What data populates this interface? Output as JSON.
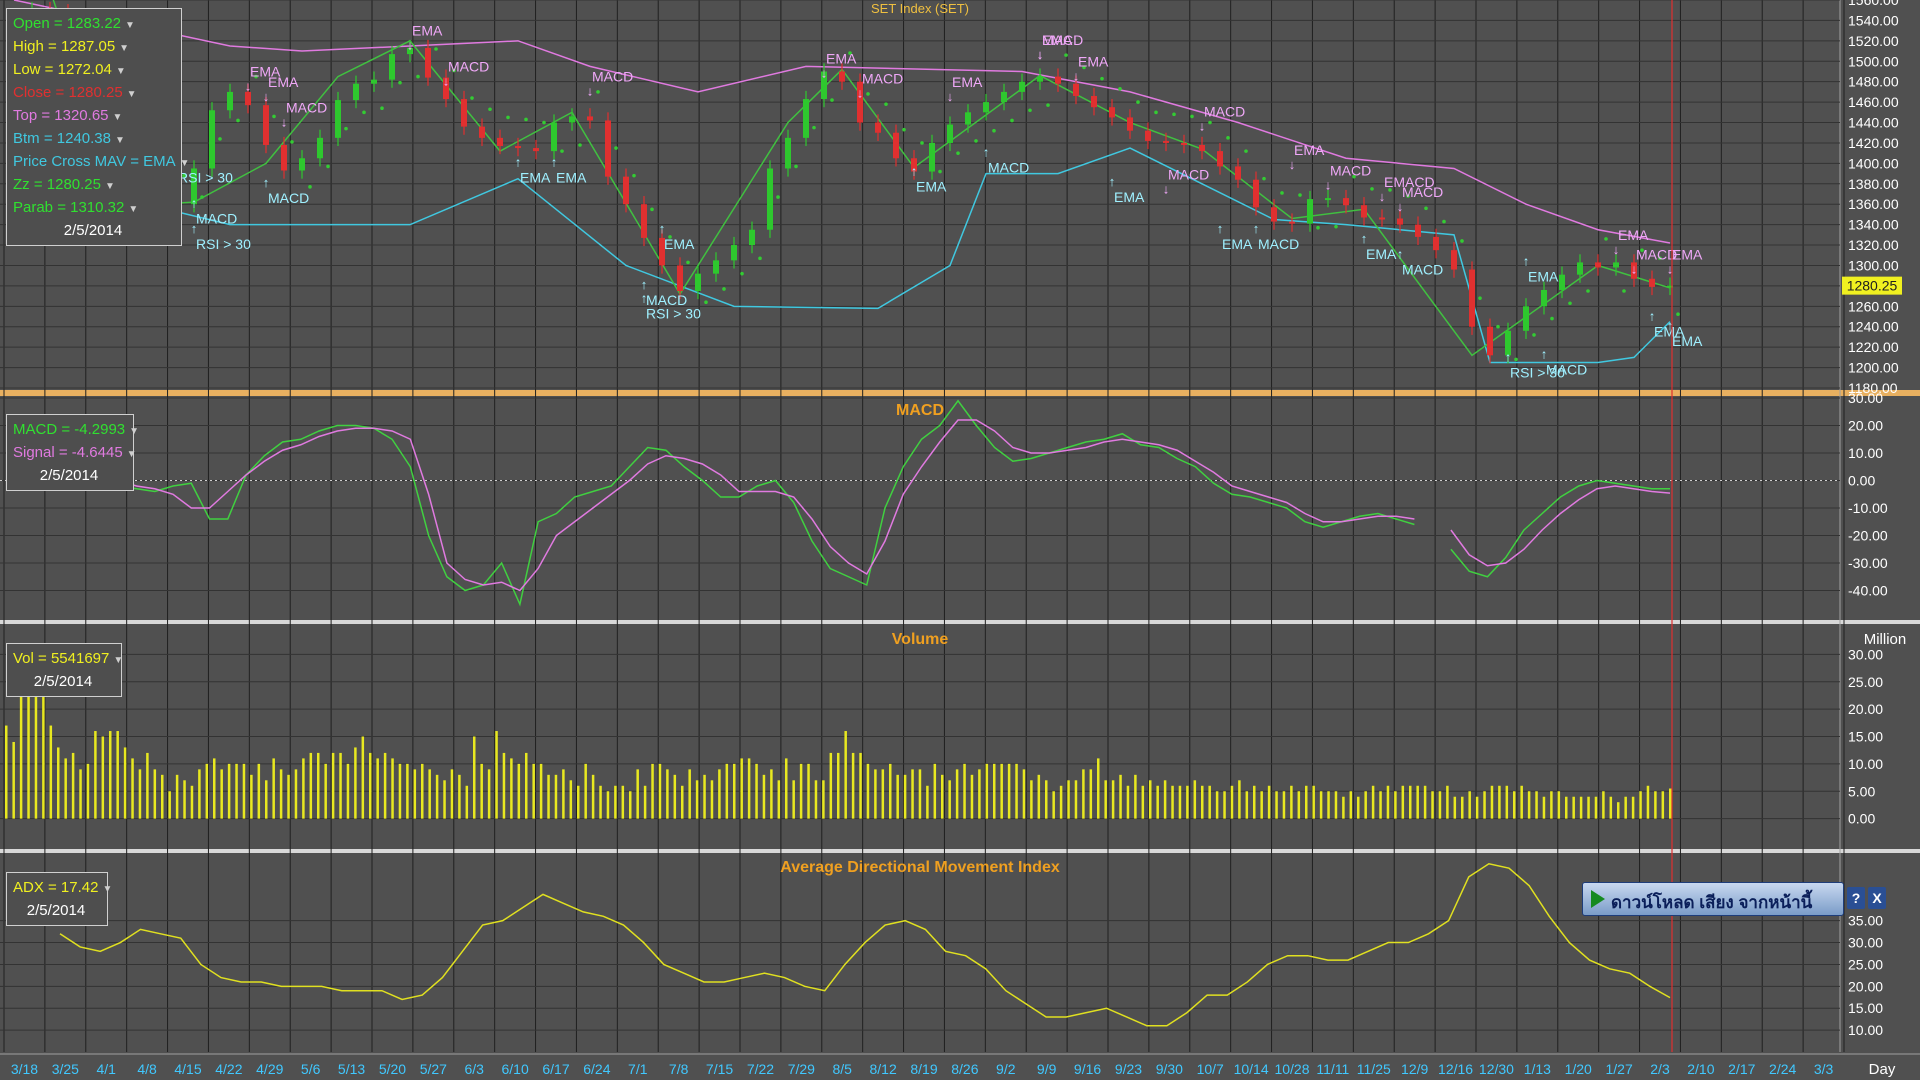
{
  "chart_data": [
    {
      "type": "candlestick",
      "title": "SET Index (SET)",
      "ylim": [
        1180,
        1560
      ],
      "y_ticks": [
        "1180.00",
        "1200.00",
        "1220.00",
        "1240.00",
        "1260.00",
        "1280.00",
        "1300.00",
        "1320.00",
        "1340.00",
        "1360.00",
        "1380.00",
        "1400.00",
        "1420.00",
        "1440.00",
        "1460.00",
        "1480.00",
        "1500.00",
        "1520.00",
        "1540.00",
        "1560.00"
      ],
      "last_price": "1280.25",
      "closes": [
        1540,
        1550,
        1548,
        1490,
        1458,
        1465,
        1368,
        1362,
        1379,
        1360,
        1395,
        1452,
        1470,
        1457,
        1418,
        1393,
        1405,
        1425,
        1462,
        1478,
        1482,
        1507,
        1513,
        1484,
        1463,
        1436,
        1425,
        1417,
        1415,
        1412,
        1440,
        1446,
        1442,
        1387,
        1360,
        1327,
        1300,
        1275,
        1292,
        1305,
        1320,
        1335,
        1395,
        1425,
        1463,
        1490,
        1480,
        1440,
        1430,
        1405,
        1392,
        1420,
        1438,
        1450,
        1460,
        1470,
        1480,
        1485,
        1478,
        1466,
        1455,
        1445,
        1432,
        1422,
        1420,
        1418,
        1412,
        1397,
        1384,
        1357,
        1343,
        1341,
        1365,
        1366,
        1359,
        1347,
        1346,
        1340,
        1328,
        1315,
        1296,
        1240,
        1212,
        1236,
        1260,
        1276,
        1291,
        1303,
        1298,
        1303,
        1287,
        1279,
        1280.25
      ],
      "zigzag": [
        [
          2,
          1570
        ],
        [
          6,
          1358
        ],
        [
          10,
          1362
        ],
        [
          14,
          1400
        ],
        [
          18,
          1485
        ],
        [
          22,
          1520
        ],
        [
          27,
          1412
        ],
        [
          31,
          1450
        ],
        [
          37,
          1272
        ],
        [
          43,
          1440
        ],
        [
          46,
          1492
        ],
        [
          50,
          1396
        ],
        [
          57,
          1486
        ],
        [
          62,
          1440
        ],
        [
          66,
          1414
        ],
        [
          71,
          1346
        ],
        [
          75,
          1355
        ],
        [
          81,
          1212
        ],
        [
          88,
          1300
        ],
        [
          92,
          1278
        ]
      ],
      "bands_top": [
        [
          0,
          1560
        ],
        [
          12,
          1515
        ],
        [
          16,
          1510
        ],
        [
          22,
          1515
        ],
        [
          28,
          1520
        ],
        [
          32,
          1495
        ],
        [
          38,
          1470
        ],
        [
          44,
          1495
        ],
        [
          56,
          1490
        ],
        [
          62,
          1470
        ],
        [
          68,
          1440
        ],
        [
          74,
          1405
        ],
        [
          80,
          1395
        ],
        [
          84,
          1360
        ],
        [
          88,
          1335
        ],
        [
          92,
          1322
        ]
      ],
      "bands_bottom": [
        [
          0,
          1460
        ],
        [
          6,
          1457
        ],
        [
          8,
          1357
        ],
        [
          12,
          1340
        ],
        [
          16,
          1340
        ],
        [
          22,
          1340
        ],
        [
          28,
          1385
        ],
        [
          34,
          1300
        ],
        [
          40,
          1260
        ],
        [
          48,
          1258
        ],
        [
          52,
          1300
        ],
        [
          54,
          1390
        ],
        [
          58,
          1390
        ],
        [
          62,
          1415
        ],
        [
          66,
          1380
        ],
        [
          70,
          1345
        ],
        [
          74,
          1340
        ],
        [
          80,
          1330
        ],
        [
          82,
          1205
        ],
        [
          88,
          1205
        ],
        [
          90,
          1210
        ],
        [
          92,
          1245
        ]
      ],
      "annotations": [
        {
          "text": "MACD",
          "i": 1,
          "y": 1500,
          "color": "#9ff0ff"
        },
        {
          "text": "RSI > 30",
          "i": 9,
          "y": 1395,
          "color": "#9ff0ff"
        },
        {
          "text": "MACD",
          "i": 10,
          "y": 1355,
          "color": "#9ff0ff"
        },
        {
          "text": "RSI > 30",
          "i": 10,
          "y": 1330,
          "color": "#9ff0ff"
        },
        {
          "text": "EMA",
          "i": 13,
          "y": 1485,
          "color": "#f0a8f8"
        },
        {
          "text": "EMA",
          "i": 14,
          "y": 1475,
          "color": "#f0a8f8"
        },
        {
          "text": "MACD",
          "i": 15,
          "y": 1450,
          "color": "#f0a8f8"
        },
        {
          "text": "MACD",
          "i": 14,
          "y": 1375,
          "color": "#9ff0ff"
        },
        {
          "text": "EMA",
          "i": 22,
          "y": 1525,
          "color": "#f0a8f8"
        },
        {
          "text": "MACD",
          "i": 24,
          "y": 1490,
          "color": "#f0a8f8"
        },
        {
          "text": "EMA",
          "i": 28,
          "y": 1395,
          "color": "#9ff0ff"
        },
        {
          "text": "EMA",
          "i": 30,
          "y": 1395,
          "color": "#9ff0ff"
        },
        {
          "text": "MACD",
          "i": 32,
          "y": 1480,
          "color": "#f0a8f8"
        },
        {
          "text": "EMA",
          "i": 36,
          "y": 1330,
          "color": "#9ff0ff"
        },
        {
          "text": "MACD",
          "i": 35,
          "y": 1275,
          "color": "#9ff0ff"
        },
        {
          "text": "RSI > 30",
          "i": 35,
          "y": 1262,
          "color": "#9ff0ff"
        },
        {
          "text": "EMA",
          "i": 45,
          "y": 1498,
          "color": "#f0a8f8"
        },
        {
          "text": "MACD",
          "i": 47,
          "y": 1478,
          "color": "#f0a8f8"
        },
        {
          "text": "EMA",
          "i": 50,
          "y": 1386,
          "color": "#9ff0ff"
        },
        {
          "text": "EMA",
          "i": 52,
          "y": 1475,
          "color": "#f0a8f8"
        },
        {
          "text": "MACD",
          "i": 54,
          "y": 1405,
          "color": "#9ff0ff"
        },
        {
          "text": "EMA",
          "i": 57,
          "y": 1516,
          "color": "#f0a8f8"
        },
        {
          "text": "MACD",
          "i": 57,
          "y": 1516,
          "color": "#f0a8f8"
        },
        {
          "text": "EMA",
          "i": 59,
          "y": 1495,
          "color": "#f0a8f8"
        },
        {
          "text": "EMA",
          "i": 61,
          "y": 1376,
          "color": "#9ff0ff"
        },
        {
          "text": "MACD",
          "i": 64,
          "y": 1384,
          "color": "#f0a8f8"
        },
        {
          "text": "MACD",
          "i": 66,
          "y": 1446,
          "color": "#f0a8f8"
        },
        {
          "text": "EMA",
          "i": 67,
          "y": 1330,
          "color": "#9ff0ff"
        },
        {
          "text": "MACD",
          "i": 69,
          "y": 1330,
          "color": "#9ff0ff"
        },
        {
          "text": "EMA",
          "i": 71,
          "y": 1408,
          "color": "#f0a8f8"
        },
        {
          "text": "MACD",
          "i": 73,
          "y": 1388,
          "color": "#f0a8f8"
        },
        {
          "text": "EMA",
          "i": 75,
          "y": 1320,
          "color": "#9ff0ff"
        },
        {
          "text": "EMACD",
          "i": 76,
          "y": 1377,
          "color": "#f0a8f8"
        },
        {
          "text": "MACD",
          "i": 77,
          "y": 1367,
          "color": "#f0a8f8"
        },
        {
          "text": "MACD",
          "i": 77,
          "y": 1305,
          "color": "#9ff0ff"
        },
        {
          "text": "EMA",
          "i": 84,
          "y": 1298,
          "color": "#9ff0ff"
        },
        {
          "text": "RSI > 30",
          "i": 83,
          "y": 1204,
          "color": "#9ff0ff"
        },
        {
          "text": "MACD",
          "i": 85,
          "y": 1207,
          "color": "#9ff0ff"
        },
        {
          "text": "EMA",
          "i": 89,
          "y": 1325,
          "color": "#f0a8f8"
        },
        {
          "text": "MACD",
          "i": 90,
          "y": 1306,
          "color": "#f0a8f8"
        },
        {
          "text": "EMA",
          "i": 92,
          "y": 1306,
          "color": "#f0a8f8"
        },
        {
          "text": "EMA",
          "i": 91,
          "y": 1244,
          "color": "#9ff0ff"
        },
        {
          "text": "EMA",
          "i": 92,
          "y": 1235,
          "color": "#9ff0ff"
        }
      ]
    },
    {
      "type": "line",
      "title": "MACD",
      "ylim": [
        -50,
        30
      ],
      "y_ticks": [
        "-40.00",
        "-30.00",
        "-20.00",
        "-10.00",
        "0.00",
        "10.00",
        "20.00",
        "30.00"
      ],
      "series": [
        {
          "name": "MACD",
          "color": "#40d040",
          "values": [
            0,
            -2,
            -3,
            -4,
            -2,
            -1,
            -14,
            -14,
            2,
            9,
            14,
            15,
            18,
            20,
            20,
            19,
            15,
            5,
            -20,
            -35,
            -40,
            -38,
            -30,
            -45,
            -15,
            -12,
            -6,
            -4,
            -2,
            5,
            12,
            11,
            5,
            0,
            -6,
            -6,
            -2,
            0,
            -8,
            -22,
            -32,
            -35,
            -38,
            -10,
            5,
            15,
            20,
            29,
            20,
            12,
            7,
            8,
            10,
            12,
            14,
            15,
            17,
            13,
            12,
            8,
            5,
            -1,
            -5,
            -6,
            -8,
            -10,
            -15,
            -17,
            -15,
            -13,
            -12,
            -14,
            -16,
            null,
            -25,
            -33,
            -35,
            -28,
            -18,
            -12,
            -6,
            -2,
            0,
            -1,
            -2,
            -3,
            -3
          ]
        },
        {
          "name": "Signal",
          "color": "#e07ae0",
          "values": [
            1,
            0,
            -2,
            -3,
            -5,
            -10,
            -10,
            -4,
            2,
            7,
            11,
            13,
            16,
            18,
            19,
            19,
            18,
            15,
            -5,
            -30,
            -36,
            -38,
            -37,
            -40,
            -32,
            -20,
            -15,
            -10,
            -5,
            0,
            6,
            9,
            8,
            6,
            2,
            -4,
            -4,
            -4,
            -6,
            -14,
            -24,
            -30,
            -34,
            -22,
            -5,
            5,
            14,
            22,
            22,
            18,
            12,
            10,
            10,
            11,
            12,
            14,
            15,
            14,
            13,
            11,
            7,
            3,
            -2,
            -4,
            -6,
            -8,
            -12,
            -15,
            -15,
            -14,
            -13,
            -13,
            -14,
            null,
            -18,
            -27,
            -31,
            -30,
            -25,
            -18,
            -12,
            -7,
            -3,
            -2,
            -3,
            -4,
            -4.6
          ]
        }
      ]
    },
    {
      "type": "bar",
      "title": "Volume",
      "unit": "Million",
      "ylim": [
        -5,
        35
      ],
      "y_ticks": [
        "0.00",
        "5.00",
        "10.00",
        "15.00",
        "20.00",
        "25.00",
        "30.00"
      ],
      "values": [
        17,
        14,
        25,
        25,
        25,
        25,
        17,
        13,
        11,
        12,
        9,
        10,
        16,
        15,
        16,
        16,
        13,
        11,
        9,
        12,
        9,
        8,
        5,
        8,
        7,
        6,
        9,
        10,
        11,
        9,
        10,
        10,
        10,
        8,
        10,
        7,
        11,
        9,
        8,
        9,
        11,
        12,
        12,
        10,
        12,
        12,
        10,
        13,
        15,
        12,
        11,
        12,
        11,
        10,
        10,
        9,
        10,
        9,
        8,
        7,
        9,
        8,
        6,
        15,
        10,
        9,
        16,
        12,
        11,
        10,
        12,
        10,
        10,
        8,
        8,
        9,
        7,
        6,
        10,
        8,
        6,
        5,
        6,
        6,
        5,
        9,
        6,
        10,
        10,
        9,
        8,
        6,
        9,
        7,
        8,
        7,
        9,
        10,
        10,
        11,
        11,
        10,
        8,
        9,
        7,
        11,
        7,
        10,
        10,
        7,
        7,
        12,
        12,
        16,
        12,
        12,
        10,
        9,
        9,
        10,
        8,
        8,
        9,
        9,
        6,
        10,
        8,
        7,
        9,
        10,
        8,
        9,
        10,
        10,
        10,
        10,
        10,
        9,
        7,
        8,
        7,
        5,
        6,
        7,
        7,
        9,
        9,
        11,
        7,
        7,
        8,
        6,
        8,
        6,
        7,
        6,
        7,
        6,
        6,
        6,
        7,
        6,
        6,
        5,
        5,
        6,
        7,
        5,
        6,
        5,
        6,
        5,
        5,
        6,
        5,
        6,
        6,
        5,
        5,
        5,
        4,
        5,
        4,
        5,
        6,
        5,
        6,
        5,
        6,
        6,
        6,
        6,
        5,
        5,
        6,
        4,
        4,
        5,
        4,
        5,
        6,
        6,
        6,
        5,
        6,
        5,
        5,
        4,
        5,
        5,
        4,
        4,
        4,
        4,
        4,
        5,
        4,
        3,
        4,
        4,
        5,
        6,
        5,
        5,
        5.5
      ]
    },
    {
      "type": "line",
      "title": "Average Directional Movement Index",
      "ylim": [
        5,
        50
      ],
      "y_ticks": [
        "10.00",
        "15.00",
        "20.00",
        "25.00",
        "30.00",
        "35.00"
      ],
      "series": [
        {
          "name": "ADX",
          "color": "#e0e020",
          "values": [
            32,
            29,
            28,
            30,
            33,
            32,
            31,
            25,
            22,
            21,
            21,
            20,
            20,
            20,
            19,
            19,
            19,
            17,
            18,
            22,
            28,
            34,
            35,
            38,
            41,
            39,
            37,
            36,
            34,
            30,
            25,
            23,
            21,
            21,
            22,
            23,
            22,
            20,
            19,
            25,
            30,
            34,
            35,
            33,
            28,
            27,
            24,
            19,
            16,
            13,
            13,
            14,
            15,
            13,
            11,
            11,
            14,
            18,
            18,
            21,
            25,
            27,
            27,
            26,
            26,
            28,
            30,
            30,
            32,
            35,
            45,
            48,
            47,
            43,
            36,
            30,
            26,
            24,
            23,
            20,
            17.42
          ]
        }
      ]
    }
  ],
  "x_axis": {
    "unit_label": "Day",
    "ticks": [
      "3/18",
      "3/25",
      "4/1",
      "4/8",
      "4/15",
      "4/22",
      "4/29",
      "5/6",
      "5/13",
      "5/20",
      "5/27",
      "6/3",
      "6/10",
      "6/17",
      "6/24",
      "7/1",
      "7/8",
      "7/15",
      "7/22",
      "7/29",
      "8/5",
      "8/12",
      "8/19",
      "8/26",
      "9/2",
      "9/9",
      "9/16",
      "9/23",
      "9/30",
      "10/7",
      "10/14",
      "10/28",
      "11/11",
      "11/25",
      "12/9",
      "12/16",
      "12/30",
      "1/13",
      "1/20",
      "1/27",
      "2/3",
      "2/10",
      "2/17",
      "2/24",
      "3/3"
    ]
  },
  "info_price": {
    "open": "Open = 1283.22",
    "high": "High = 1287.05",
    "low": "Low = 1272.04",
    "close": "Close = 1280.25",
    "top": "Top = 1320.65",
    "btm": "Btm = 1240.38",
    "pcm": "Price Cross MAV = EMA",
    "zz": "Zz = 1280.25",
    "parab": "Parab = 1310.32",
    "date": "2/5/2014"
  },
  "info_macd": {
    "macd": "MACD = -4.2993",
    "signal": "Signal = -4.6445",
    "date": "2/5/2014"
  },
  "info_vol": {
    "vol": "Vol = 5541697",
    "date": "2/5/2014"
  },
  "info_adx": {
    "adx": "ADX = 17.42",
    "date": "2/5/2014"
  },
  "popup": {
    "label": "ดาวน์โหลด เสียง จากหน้านี้",
    "help": "?",
    "close": "X"
  },
  "colors": {
    "background": "#505050",
    "up": "#2ec82e",
    "down": "#e03030",
    "top_band": "#e07ae0",
    "bottom_band": "#40c8e0",
    "zigzag": "#40c040",
    "parabolic": "#33cc33",
    "panel_title": "#f0a020",
    "divider": "#e8b060",
    "cursor": "#e03030"
  }
}
